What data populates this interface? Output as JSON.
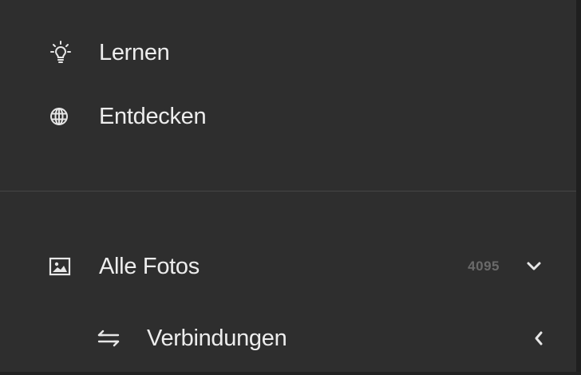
{
  "nav": {
    "learn": {
      "label": "Lernen",
      "icon": "lightbulb-icon"
    },
    "discover": {
      "label": "Entdecken",
      "icon": "globe-icon"
    }
  },
  "library": {
    "all_photos": {
      "label": "Alle Fotos",
      "count": "4095",
      "icon": "photo-icon",
      "chevron": "chevron-down-icon"
    },
    "connections": {
      "label": "Verbindungen",
      "icon": "sync-arrows-icon",
      "chevron": "chevron-left-icon"
    }
  },
  "colors": {
    "background": "#2e2e2e",
    "text": "#ededed",
    "muted": "#6a6a6a",
    "divider": "#464646"
  }
}
